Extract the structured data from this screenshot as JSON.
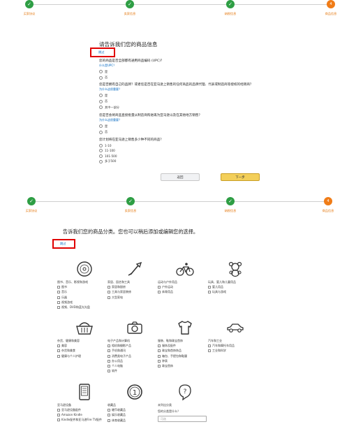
{
  "steps": [
    "买家协议",
    "卖家信息",
    "纳税信息",
    "商品信息"
  ],
  "current_step": "4",
  "panel1": {
    "title": "请告诉我们您的商品信息",
    "skip": "跳过",
    "questions": [
      {
        "title": "您的商品是否全部都有通用商品编码 (UPC)？",
        "help": "什么是UPC？",
        "options": [
          "是",
          "否"
        ]
      },
      {
        "title": "您是否拥有自己的品牌？或者您是否在亚马逊上销售的任何商品的品牌代理、代表或制造商等授权的经销商？",
        "help": "为什么这很重要？",
        "options": [
          "是",
          "否",
          "其中一部分"
        ]
      },
      {
        "title": "您是否会将商品直接批量从制造商购进再为亚马逊以及在其他地方销售？",
        "help": "为什么这很重要？",
        "options": [
          "是",
          "否"
        ]
      },
      {
        "title": "您计划将在亚马逊上销售多少种不同的商品？",
        "help": "",
        "options": [
          "1-10",
          "11-100",
          "101-500",
          "多于500"
        ]
      }
    ],
    "back": "返回",
    "next": "下一步"
  },
  "panel2": {
    "title": "告诉我们您的商品分类。您也可以稍后添加或编辑您的选择。",
    "skip": "跳过",
    "categories": [
      {
        "icon": "disc-icon",
        "label": "图书、音乐、影视和游戏",
        "subs": [
          "图书",
          "音乐",
          "乐器",
          "视频游戏",
          "视频、DVD和蓝光光盘"
        ]
      },
      {
        "icon": "shovel-icon",
        "label": "家居、园艺和工具",
        "subs": [
          "家居和厨房",
          "工具与家居装修",
          "大型家电"
        ]
      },
      {
        "icon": "bicycle-icon",
        "label": "运动与户外用品",
        "subs": [
          "户外运动",
          "体育用品"
        ]
      },
      {
        "icon": "teddy-bear-icon",
        "label": "玩具、婴儿和儿童用品",
        "subs": [
          "婴儿用品",
          "玩具与游戏"
        ]
      },
      {
        "icon": "basket-icon",
        "label": "杂货、健康和美容",
        "subs": [
          "美容",
          "杂货和美食",
          "健康与个人护理"
        ]
      },
      {
        "icon": "camera-icon",
        "label": "电子产品和计算机",
        "subs": [
          "相机和摄影产品",
          "手机和通讯",
          "消费类电子产品",
          "办公用品",
          "个人电脑",
          "软件"
        ]
      },
      {
        "icon": "shirt-icon",
        "label": "服装、鞋和珠宝首饰",
        "subs": [
          "服饰及配件",
          "珠宝和首饰饰品",
          "箱包、手提包和鞋履",
          "钟表",
          "珠宝首饰"
        ]
      },
      {
        "icon": "car-icon",
        "label": "汽车和工业",
        "subs": [
          "汽车和摩托车用品",
          "工业和科学"
        ]
      },
      {
        "icon": "kindle-icon",
        "label": "亚马逊设备",
        "subs": [
          "亚马逊设备配件",
          "Amazon Kindle",
          "Kindle配件和亚马逊Fire TV配件"
        ]
      },
      {
        "icon": "coin-icon",
        "label": "收藏品",
        "subs": [
          "硬币收藏品",
          "娱乐收藏品",
          "体育收藏品"
        ]
      },
      {
        "icon": "question-icon",
        "label": "未列出分类",
        "subs": [],
        "prompt": "您的分类是什么？",
        "placeholder": "可选"
      }
    ]
  }
}
